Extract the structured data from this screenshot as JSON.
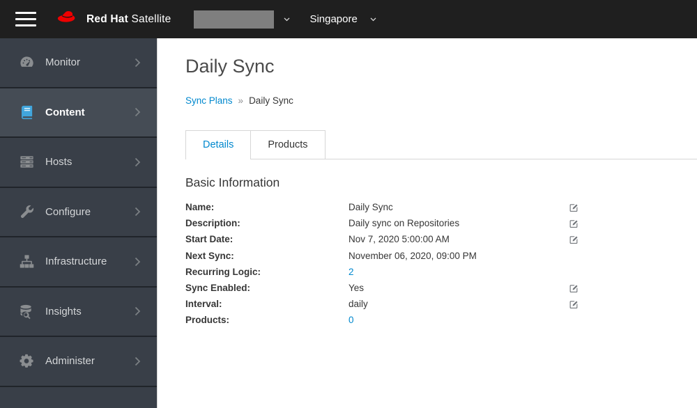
{
  "colors": {
    "accent": "#0088ce",
    "header_bg": "#1f1f1f",
    "sidebar_bg": "#393f48",
    "sidebar_active_bg": "#454c55",
    "brand_red": "#ee0000"
  },
  "header": {
    "brand": {
      "bold": "Red Hat",
      "regular": "Satellite"
    },
    "org_dropdown": {
      "value": ""
    },
    "location_dropdown": {
      "value": "Singapore"
    }
  },
  "sidebar": {
    "items": [
      {
        "label": "Monitor",
        "icon": "gauge-icon",
        "active": false
      },
      {
        "label": "Content",
        "icon": "book-icon",
        "active": true
      },
      {
        "label": "Hosts",
        "icon": "servers-icon",
        "active": false
      },
      {
        "label": "Configure",
        "icon": "wrench-icon",
        "active": false
      },
      {
        "label": "Infrastructure",
        "icon": "sitemap-icon",
        "active": false
      },
      {
        "label": "Insights",
        "icon": "database-search-icon",
        "active": false
      },
      {
        "label": "Administer",
        "icon": "gear-icon",
        "active": false
      }
    ]
  },
  "main": {
    "title": "Daily Sync",
    "breadcrumb": {
      "link": "Sync Plans",
      "separator": "»",
      "current": "Daily Sync"
    },
    "tabs": [
      {
        "label": "Details",
        "active": true
      },
      {
        "label": "Products",
        "active": false
      }
    ],
    "section_title": "Basic Information",
    "fields": [
      {
        "label": "Name:",
        "value": "Daily Sync",
        "editable": true,
        "link": false
      },
      {
        "label": "Description:",
        "value": "Daily sync on Repositories",
        "editable": true,
        "link": false
      },
      {
        "label": "Start Date:",
        "value": "Nov 7, 2020 5:00:00 AM",
        "editable": true,
        "link": false
      },
      {
        "label": "Next Sync:",
        "value": "November 06, 2020, 09:00 PM",
        "editable": false,
        "link": false
      },
      {
        "label": "Recurring Logic:",
        "value": "2",
        "editable": false,
        "link": true
      },
      {
        "label": "Sync Enabled:",
        "value": "Yes",
        "editable": true,
        "link": false
      },
      {
        "label": "Interval:",
        "value": "daily",
        "editable": true,
        "link": false
      },
      {
        "label": "Products:",
        "value": "0",
        "editable": false,
        "link": true
      }
    ]
  }
}
